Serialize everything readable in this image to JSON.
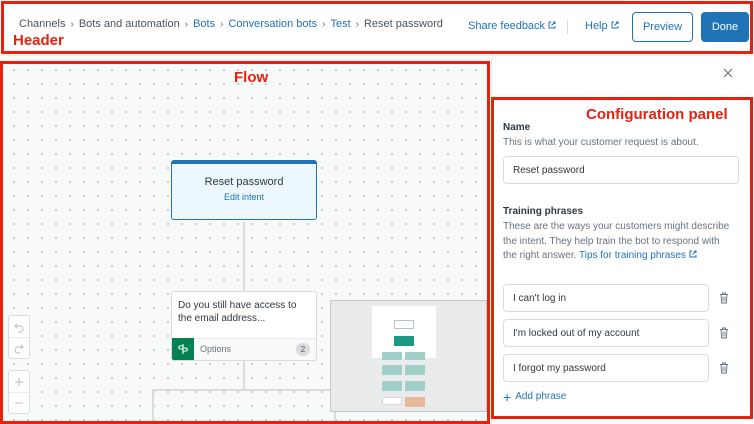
{
  "header": {
    "breadcrumb": [
      {
        "label": "Channels",
        "link": false
      },
      {
        "label": "Bots and automation",
        "link": false
      },
      {
        "label": "Bots",
        "link": true
      },
      {
        "label": "Conversation bots",
        "link": true
      },
      {
        "label": "Test",
        "link": true
      },
      {
        "label": "Reset password",
        "link": false
      }
    ],
    "share_feedback": "Share feedback",
    "help": "Help",
    "preview_label": "Preview",
    "done_label": "Done"
  },
  "annotations": {
    "header": "Header",
    "flow": "Flow",
    "config_panel": "Configuration panel",
    "color": "#e8210e"
  },
  "flow": {
    "intent_node": {
      "title": "Reset password",
      "edit_label": "Edit intent"
    },
    "question_node": {
      "text": "Do you still have access to the email address...",
      "options_label": "Options",
      "options_count": "2"
    }
  },
  "panel": {
    "name_label": "Name",
    "name_hint": "This is what your customer request is about.",
    "name_value": "Reset password",
    "training_label": "Training phrases",
    "training_hint": "These are the ways your customers might describe the intent. They help train the bot to respond with the right answer.",
    "tips_link": "Tips for training phrases",
    "phrases": [
      "I can't log in",
      "I'm locked out of my account",
      "I forgot my password"
    ],
    "add_phrase_label": "Add phrase"
  },
  "colors": {
    "accent": "#1f73b7",
    "options_green": "#038153",
    "annotation_red": "#e8210e"
  },
  "icons": [
    "external-link-icon",
    "close-icon",
    "options-icon",
    "undo-icon",
    "redo-icon",
    "zoom-in-icon",
    "zoom-out-icon",
    "trash-icon",
    "plus-icon"
  ]
}
